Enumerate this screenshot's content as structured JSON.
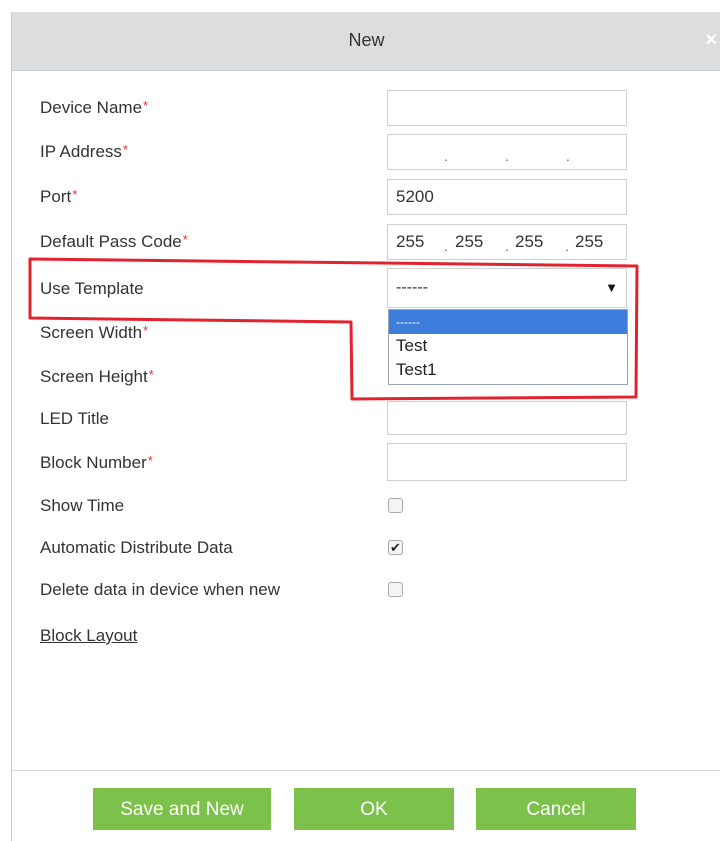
{
  "dialog": {
    "title": "New",
    "close_glyph": "×"
  },
  "form": {
    "required_mark": "*",
    "device_name": {
      "label": "Device Name",
      "value": ""
    },
    "ip_address": {
      "label": "IP Address",
      "segments": [
        "",
        "",
        "",
        ""
      ],
      "separator": "."
    },
    "port": {
      "label": "Port",
      "value": "5200"
    },
    "default_pass_code": {
      "label": "Default Pass Code",
      "segments": [
        "255",
        "255",
        "255",
        "255"
      ],
      "separator": "."
    },
    "use_template": {
      "label": "Use Template",
      "selected": "------",
      "arrow_glyph": "▼",
      "options": [
        "------",
        "Test",
        "Test1"
      ]
    },
    "screen_width": {
      "label": "Screen Width",
      "value": ""
    },
    "screen_height": {
      "label": "Screen Height",
      "value": ""
    },
    "led_title": {
      "label": "LED Title",
      "value": ""
    },
    "block_number": {
      "label": "Block Number",
      "value": ""
    },
    "show_time": {
      "label": "Show Time",
      "checked": false
    },
    "automatic_distribute": {
      "label": "Automatic Distribute Data",
      "checked": true,
      "check_glyph": "✔"
    },
    "delete_data": {
      "label": "Delete data in device when new",
      "checked": false
    },
    "block_layout_link": "Block Layout"
  },
  "buttons": {
    "save_and_new": "Save and New",
    "ok": "OK",
    "cancel": "Cancel"
  },
  "colors": {
    "button_green": "#7cc14a",
    "highlight_red": "#e0232e",
    "required_red": "#e0302e",
    "selected_option_blue": "#3d7edb",
    "title_bar": "#dcdddf"
  }
}
